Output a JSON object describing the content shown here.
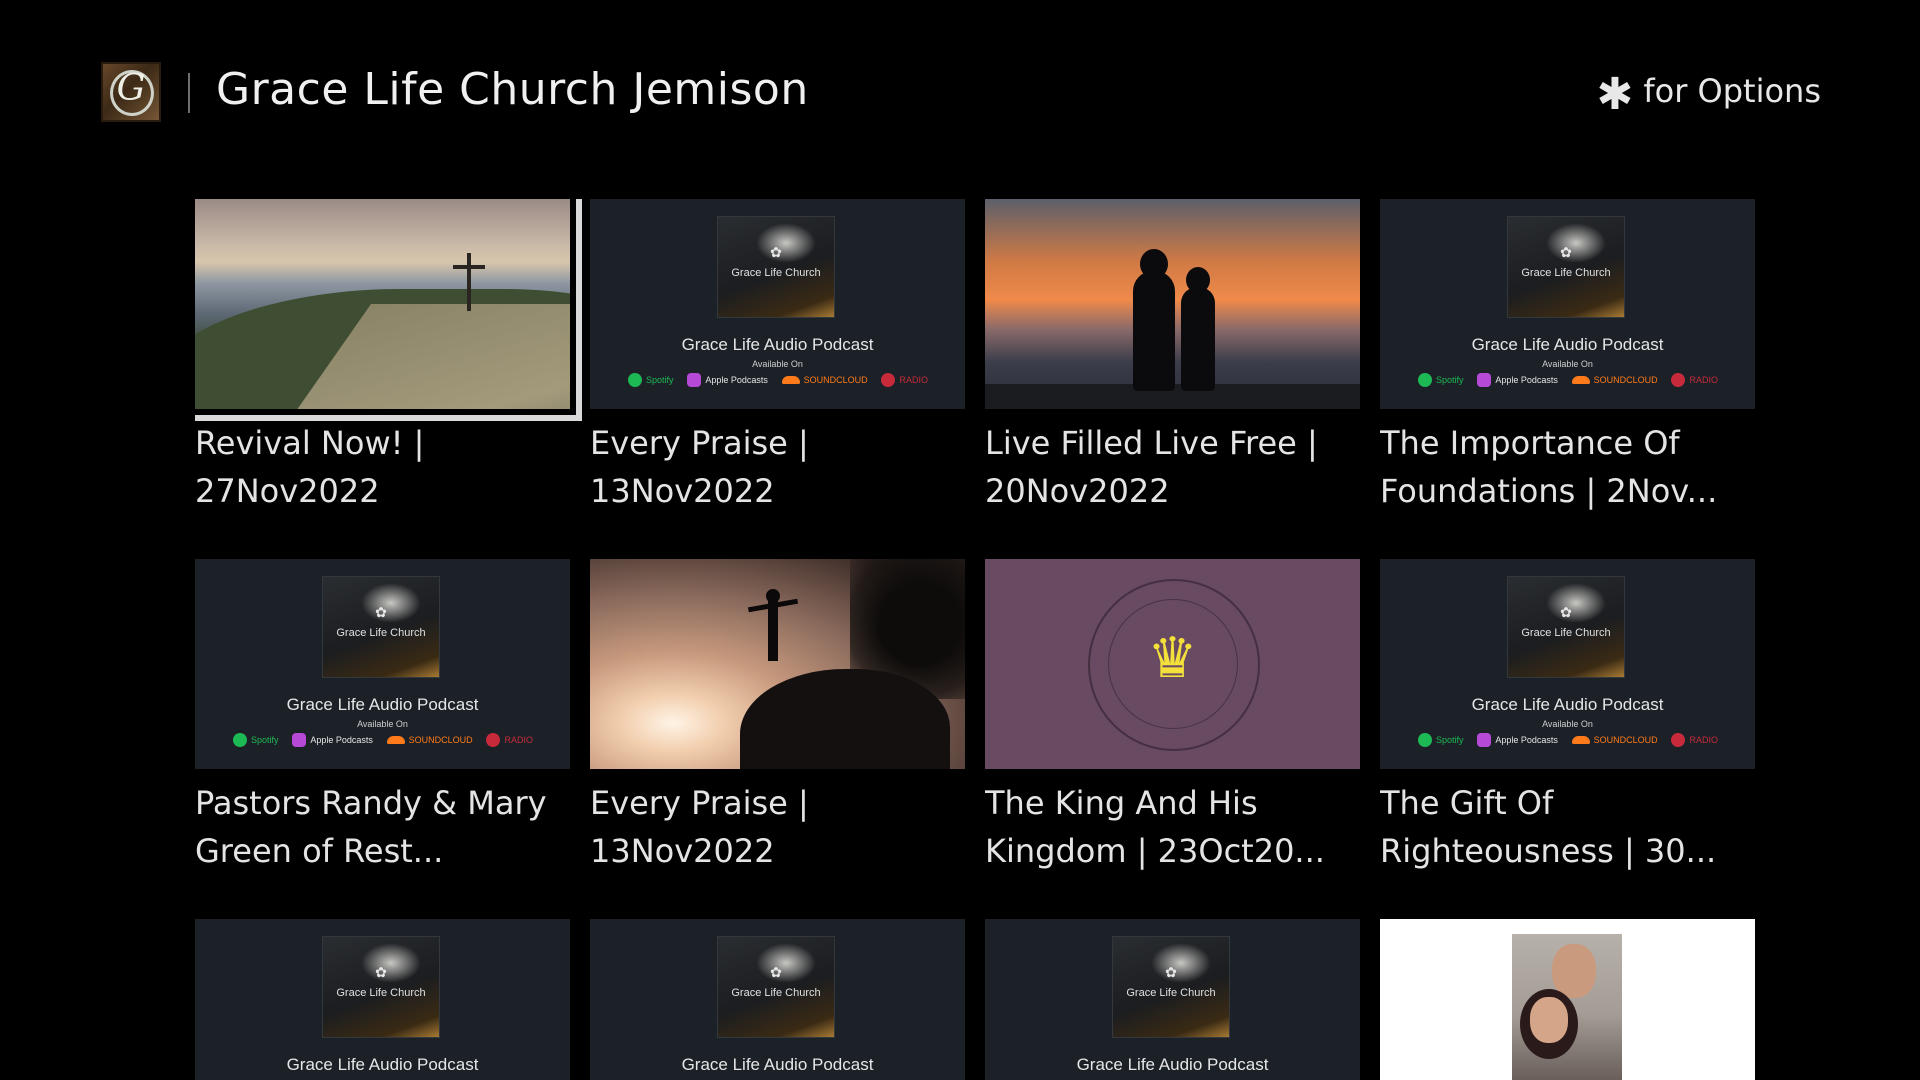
{
  "header": {
    "channel_title": "Grace Life Church Jemison",
    "logo_letter": "G",
    "options_icon": "asterisk-icon",
    "options_star": "✱",
    "options_label": "for Options"
  },
  "podcast_art": {
    "album_church": "Grace Life Church",
    "title": "Grace Life Audio Podcast",
    "available": "Available On",
    "services": [
      "Spotify",
      "Apple Podcasts",
      "SOUNDCLOUD",
      "RADIO"
    ]
  },
  "tiles": [
    {
      "label": "Revival Now! | 27Nov2022",
      "art": "mountain-cross",
      "focused": true
    },
    {
      "label": "Every Praise | 13Nov2022",
      "art": "podcast"
    },
    {
      "label": "Live Filled Live Free | 20Nov2022",
      "art": "sunset-couple"
    },
    {
      "label": "The Importance Of Foundations | 2Nov...",
      "art": "podcast"
    },
    {
      "label": "Pastors Randy & Mary Green of Rest...",
      "art": "podcast"
    },
    {
      "label": "Every Praise | 13Nov2022",
      "art": "rock-silhouette"
    },
    {
      "label": "The King And His Kingdom | 23Oct20...",
      "art": "crown"
    },
    {
      "label": "The Gift Of Righteousness | 30...",
      "art": "podcast"
    },
    {
      "label": "",
      "art": "podcast"
    },
    {
      "label": "",
      "art": "podcast"
    },
    {
      "label": "",
      "art": "podcast"
    },
    {
      "label": "",
      "art": "portrait"
    }
  ],
  "crown_glyph": "♛"
}
